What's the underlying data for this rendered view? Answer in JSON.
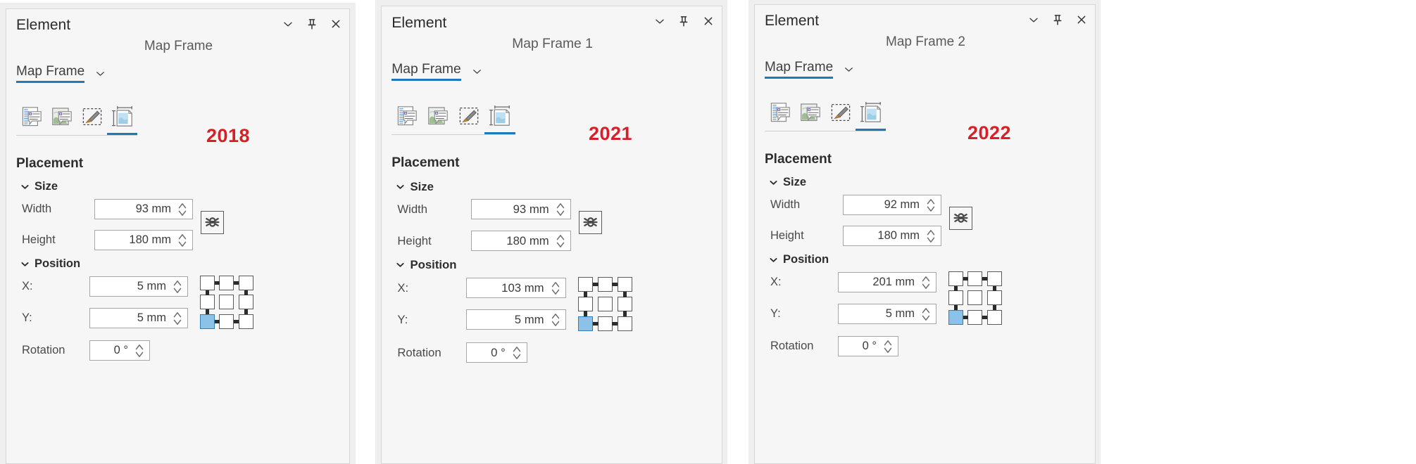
{
  "panels": [
    {
      "id": "panel-2018",
      "window_title": "Element",
      "element_name": "Map Frame",
      "tab_label": "Map Frame",
      "year_label": "2018",
      "toolbar_icons": [
        "map-frame-options-icon",
        "map-frame-display-icon",
        "map-frame-style-icon",
        "map-frame-placement-icon"
      ],
      "active_toolbar_index": 3,
      "section": {
        "title": "Placement",
        "size_group": "Size",
        "position_group": "Position"
      },
      "fields": [
        {
          "label": "Width",
          "value": "93 mm"
        },
        {
          "label": "Height",
          "value": "180 mm"
        },
        {
          "label": "X:",
          "value": "5 mm"
        },
        {
          "label": "Y:",
          "value": "5 mm"
        },
        {
          "label": "Rotation",
          "value": "0 °"
        }
      ],
      "anchor_selected": "bottom-left",
      "aspect_lock_icon": "aspect-ratio-unlocked-icon",
      "window_buttons": [
        "chevron-down-icon",
        "pin-icon",
        "close-icon"
      ]
    },
    {
      "id": "panel-2021",
      "window_title": "Element",
      "element_name": "Map Frame 1",
      "tab_label": "Map Frame",
      "year_label": "2021",
      "toolbar_icons": [
        "map-frame-options-icon",
        "map-frame-display-icon",
        "map-frame-style-icon",
        "map-frame-placement-icon"
      ],
      "active_toolbar_index": 3,
      "section": {
        "title": "Placement",
        "size_group": "Size",
        "position_group": "Position"
      },
      "fields": [
        {
          "label": "Width",
          "value": "93 mm"
        },
        {
          "label": "Height",
          "value": "180 mm"
        },
        {
          "label": "X:",
          "value": "103 mm"
        },
        {
          "label": "Y:",
          "value": "5 mm"
        },
        {
          "label": "Rotation",
          "value": "0 °"
        }
      ],
      "anchor_selected": "bottom-left",
      "aspect_lock_icon": "aspect-ratio-unlocked-icon",
      "window_buttons": [
        "chevron-down-icon",
        "pin-icon",
        "close-icon"
      ]
    },
    {
      "id": "panel-2022",
      "window_title": "Element",
      "element_name": "Map Frame 2",
      "tab_label": "Map Frame",
      "year_label": "2022",
      "toolbar_icons": [
        "map-frame-options-icon",
        "map-frame-display-icon",
        "map-frame-style-icon",
        "map-frame-placement-icon"
      ],
      "active_toolbar_index": 3,
      "section": {
        "title": "Placement",
        "size_group": "Size",
        "position_group": "Position"
      },
      "fields": [
        {
          "label": "Width",
          "value": "92 mm"
        },
        {
          "label": "Height",
          "value": "180 mm"
        },
        {
          "label": "X:",
          "value": "201 mm"
        },
        {
          "label": "Y:",
          "value": "5 mm"
        },
        {
          "label": "Rotation",
          "value": "0 °"
        }
      ],
      "anchor_selected": "bottom-left",
      "aspect_lock_icon": "aspect-ratio-unlocked-icon",
      "window_buttons": [
        "chevron-down-icon",
        "pin-icon",
        "close-icon"
      ]
    }
  ],
  "colors": {
    "accent": "#1f79b7",
    "year_red": "#d91f26",
    "anchor_selected": "#8cc2e8",
    "panel_bg": "#f6f6f6",
    "field_bg": "#ffffff"
  }
}
